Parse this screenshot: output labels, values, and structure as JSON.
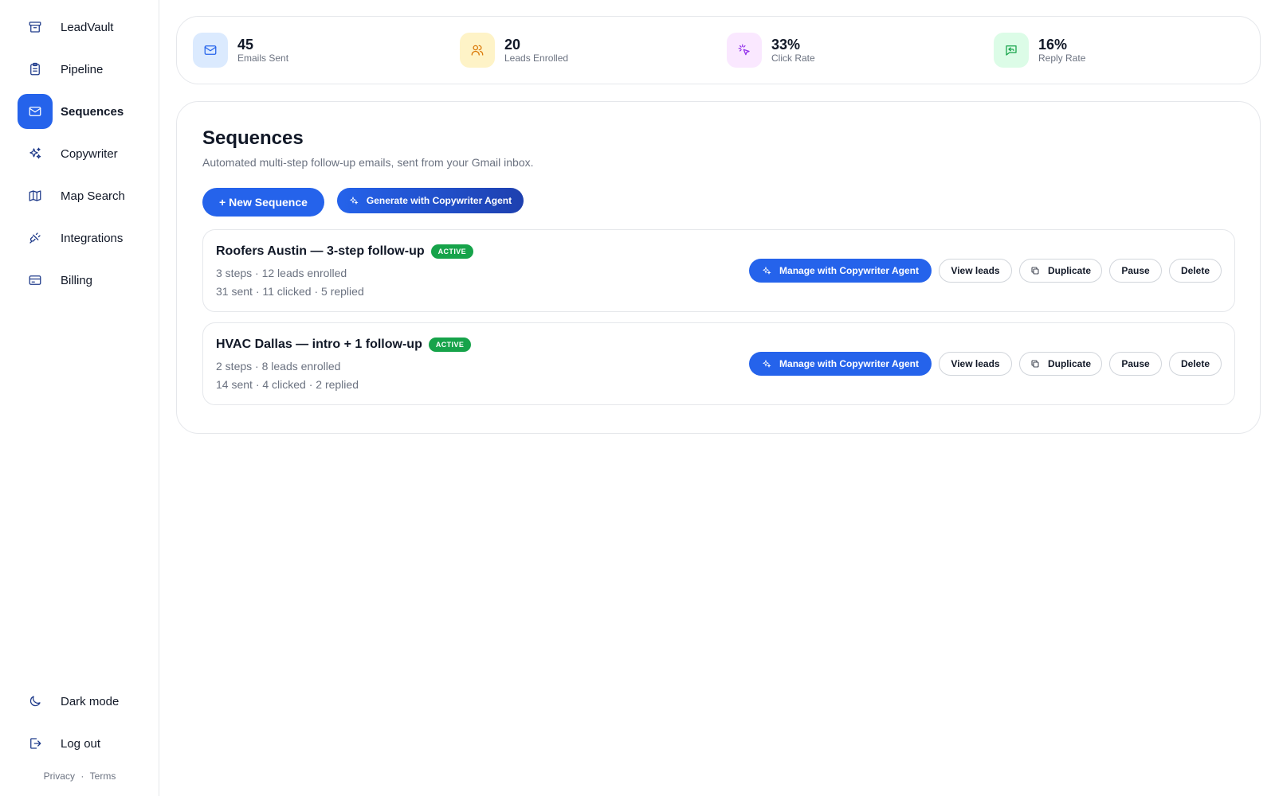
{
  "sidebar": {
    "items": [
      {
        "label": "LeadVault",
        "icon": "archive-icon",
        "active": false
      },
      {
        "label": "Pipeline",
        "icon": "clipboard-icon",
        "active": false
      },
      {
        "label": "Sequences",
        "icon": "mail-icon",
        "active": true
      },
      {
        "label": "Copywriter",
        "icon": "sparkles-icon",
        "active": false
      },
      {
        "label": "Map Search",
        "icon": "map-icon",
        "active": false
      },
      {
        "label": "Integrations",
        "icon": "plug-icon",
        "active": false
      },
      {
        "label": "Billing",
        "icon": "credit-card-icon",
        "active": false
      }
    ],
    "bottom": [
      {
        "label": "Dark mode",
        "icon": "moon-icon"
      },
      {
        "label": "Log out",
        "icon": "logout-icon"
      }
    ],
    "legal": {
      "privacy": "Privacy",
      "separator": "·",
      "terms": "Terms"
    }
  },
  "stats": [
    {
      "value": "45",
      "label": "Emails Sent",
      "icon": "mail-icon",
      "bg": "#dbeafe",
      "fg": "#2563eb"
    },
    {
      "value": "20",
      "label": "Leads Enrolled",
      "icon": "users-icon",
      "bg": "#fef3c7",
      "fg": "#d97706"
    },
    {
      "value": "33%",
      "label": "Click Rate",
      "icon": "click-icon",
      "bg": "#fae8ff",
      "fg": "#9333ea"
    },
    {
      "value": "16%",
      "label": "Reply Rate",
      "icon": "reply-icon",
      "bg": "#dcfce7",
      "fg": "#16a34a"
    }
  ],
  "main": {
    "title": "Sequences",
    "subtitle": "Automated multi-step follow-up emails, sent from your Gmail inbox.",
    "new_button": "+ New Sequence",
    "generate_button": "Generate with Copywriter Agent"
  },
  "sequences": [
    {
      "title": "Roofers Austin — 3-step follow-up",
      "status": "ACTIVE",
      "meta1": "3 steps · 12 leads enrolled",
      "meta2": "31 sent · 11 clicked · 5 replied"
    },
    {
      "title": "HVAC Dallas — intro + 1 follow-up",
      "status": "ACTIVE",
      "meta1": "2 steps · 8 leads enrolled",
      "meta2": "14 sent · 4 clicked · 2 replied"
    }
  ],
  "actions": {
    "manage": "Manage with Copywriter Agent",
    "view_leads": "View leads",
    "duplicate": "Duplicate",
    "pause": "Pause",
    "delete": "Delete"
  },
  "colors": {
    "accent": "#2563eb",
    "active_badge": "#16a34a"
  }
}
